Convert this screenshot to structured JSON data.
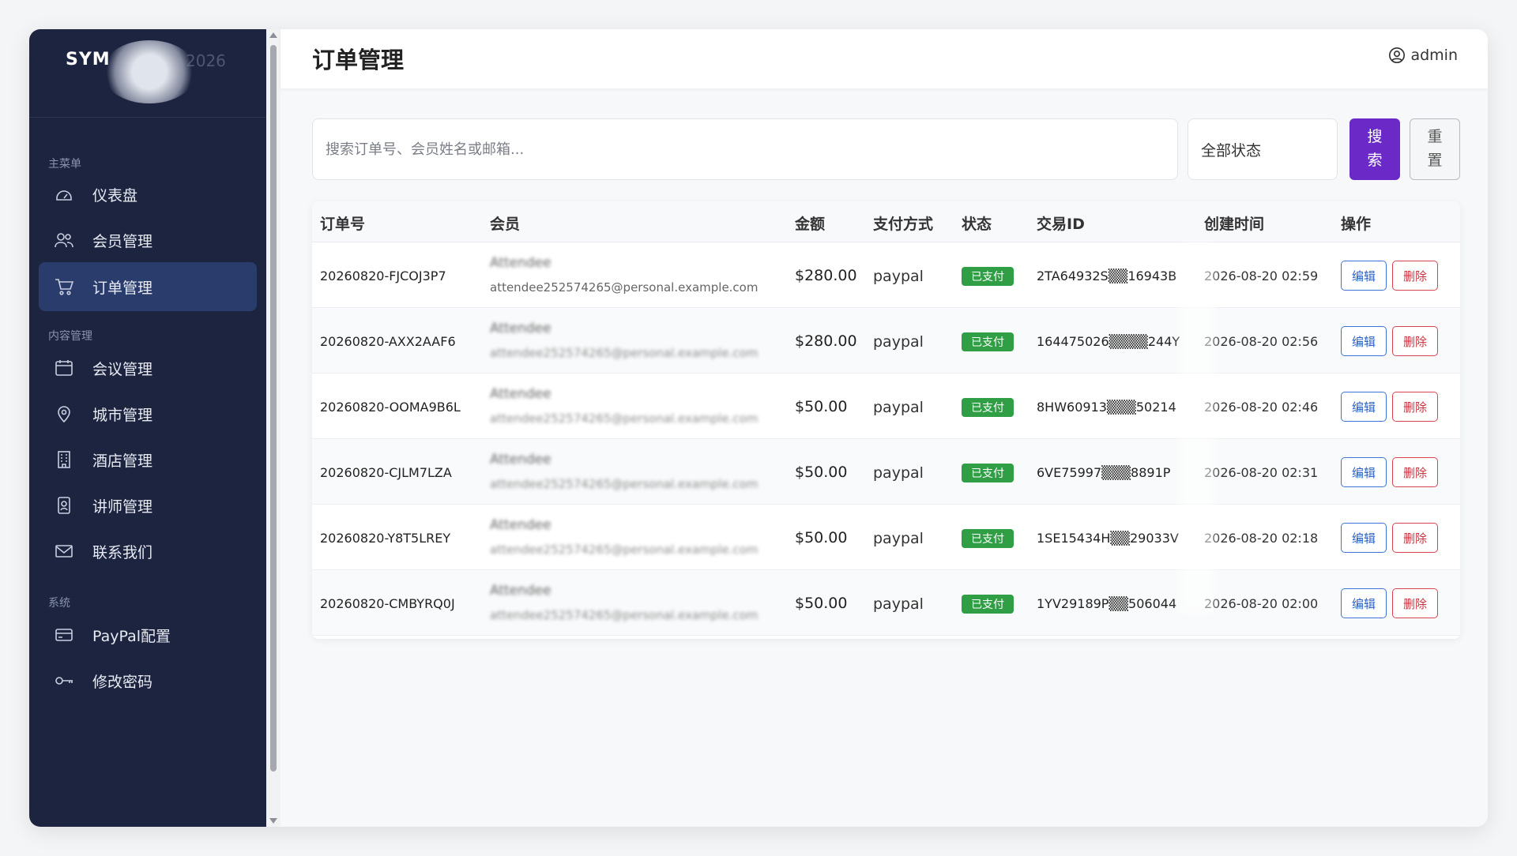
{
  "sidebar": {
    "brand_title": "SYM",
    "brand_sub": "",
    "brand_year": "2026",
    "sections": {
      "main": "主菜单",
      "content": "内容管理",
      "system": "系统"
    },
    "items": [
      {
        "label": "仪表盘",
        "icon": "dashboard-icon"
      },
      {
        "label": "会员管理",
        "icon": "users-icon"
      },
      {
        "label": "订单管理",
        "icon": "cart-icon",
        "active": true
      },
      {
        "label": "会议管理",
        "icon": "calendar-icon"
      },
      {
        "label": "城市管理",
        "icon": "location-pin-icon"
      },
      {
        "label": "酒店管理",
        "icon": "building-icon"
      },
      {
        "label": "讲师管理",
        "icon": "id-badge-icon"
      },
      {
        "label": "联系我们",
        "icon": "mail-icon"
      },
      {
        "label": "PayPal配置",
        "icon": "credit-card-icon"
      },
      {
        "label": "修改密码",
        "icon": "key-icon"
      }
    ]
  },
  "header": {
    "title": "订单管理",
    "user": "admin"
  },
  "filters": {
    "search_placeholder": "搜索订单号、会员姓名或邮箱...",
    "status_value": "全部状态",
    "search_label_1": "搜",
    "search_label_2": "索",
    "reset_label_1": "重",
    "reset_label_2": "置"
  },
  "table": {
    "columns": [
      "订单号",
      "会员",
      "金额",
      "支付方式",
      "状态",
      "交易ID",
      "创建时间",
      "操作"
    ],
    "edit_label": "编辑",
    "delete_label": "删除",
    "rows": [
      {
        "order_no": "20260820-FJCOJ3P7",
        "member": "Attendee",
        "email": "attendee252574265@personal.example.com",
        "amount": "$280.00",
        "method": "paypal",
        "status": "已支付",
        "txid": "2TA64932S▒▒16943B",
        "created": "2026-08-20 02:59"
      },
      {
        "order_no": "20260820-AXX2AAF6",
        "member": "Attendee",
        "email": "attendee252574265@personal.example.com",
        "amount": "$280.00",
        "method": "paypal",
        "status": "已支付",
        "txid": "164475026▒▒▒▒244Y",
        "created": "2026-08-20 02:56"
      },
      {
        "order_no": "20260820-OOMA9B6L",
        "member": "Attendee",
        "email": "attendee252574265@personal.example.com",
        "amount": "$50.00",
        "method": "paypal",
        "status": "已支付",
        "txid": "8HW60913▒▒▒50214",
        "created": "2026-08-20 02:46"
      },
      {
        "order_no": "20260820-CJLM7LZA",
        "member": "Attendee",
        "email": "attendee252574265@personal.example.com",
        "amount": "$50.00",
        "method": "paypal",
        "status": "已支付",
        "txid": "6VE75997▒▒▒8891P",
        "created": "2026-08-20 02:31"
      },
      {
        "order_no": "20260820-Y8T5LREY",
        "member": "Attendee",
        "email": "attendee252574265@personal.example.com",
        "amount": "$50.00",
        "method": "paypal",
        "status": "已支付",
        "txid": "1SE15434H▒▒29033V",
        "created": "2026-08-20 02:18"
      },
      {
        "order_no": "20260820-CMBYRQ0J",
        "member": "Attendee",
        "email": "attendee252574265@personal.example.com",
        "amount": "$50.00",
        "method": "paypal",
        "status": "已支付",
        "txid": "1YV29189P▒▒506044",
        "created": "2026-08-20 02:00"
      }
    ]
  },
  "colors": {
    "sidebar_bg": "#1c2440",
    "active_item": "#2a3c6b",
    "search_button": "#6b29c8",
    "paid_badge": "#2f9e44",
    "edit_border": "#3d74d6",
    "delete_border": "#d6454f"
  }
}
